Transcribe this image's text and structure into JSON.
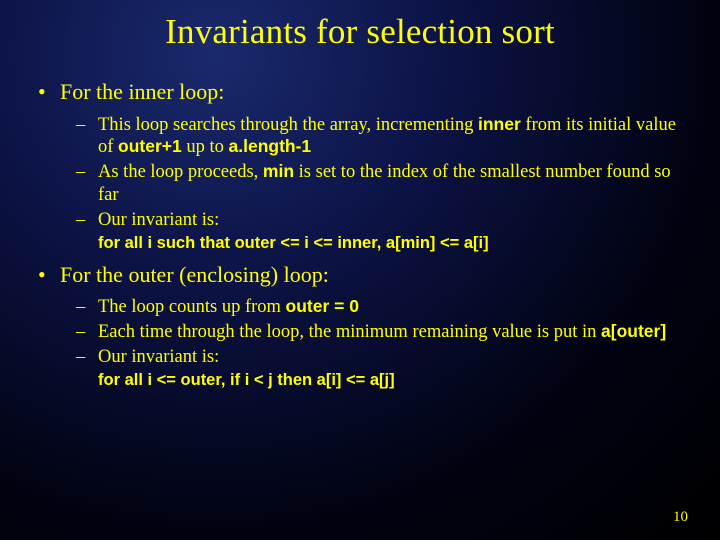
{
  "title": "Invariants for selection sort",
  "bullets": {
    "b1": "For the inner loop:",
    "b1_s1_a": "This loop searches through the array, incrementing ",
    "b1_s1_code1": "inner",
    "b1_s1_b": " from its initial value of ",
    "b1_s1_code2": "outer+1",
    "b1_s1_c": " up to ",
    "b1_s1_code3": "a.length-1",
    "b1_s2_a": "As the loop proceeds, ",
    "b1_s2_code1": "min",
    "b1_s2_b": " is set to the index of the smallest number found so far",
    "b1_s3": "Our invariant is:",
    "b1_inv": "for all i such that outer <= i <= inner, a[min] <= a[i]",
    "b2": "For the outer (enclosing) loop:",
    "b2_s1_a": "The loop counts up from ",
    "b2_s1_code1": "outer = 0",
    "b2_s2_a": "Each time through the loop, the minimum remaining value is put in ",
    "b2_s2_code1": "a[outer]",
    "b2_s3": "Our invariant is:",
    "b2_inv": "for all i <= outer, if i < j then a[i] <= a[j]"
  },
  "page_number": "10"
}
